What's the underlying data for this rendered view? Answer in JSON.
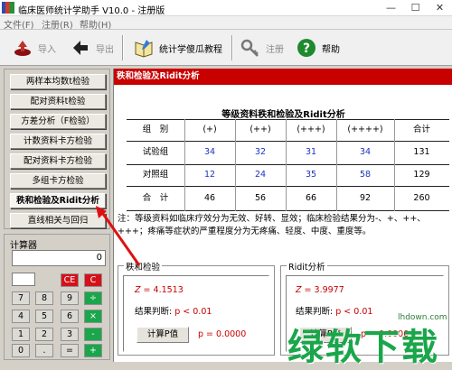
{
  "window": {
    "title": "临床医师统计学助手 V10.0 - 注册版",
    "min": "—",
    "max": "☐",
    "close": "✕"
  },
  "menu": [
    "文件(F)",
    "注册(R)",
    "帮助(H)"
  ],
  "toolbar": {
    "import": "导入",
    "export": "导出",
    "tutorial": "统计学傻瓜教程",
    "register": "注册",
    "help": "帮助"
  },
  "nav": [
    "两样本均数t检验",
    "配对资料t检验",
    "方差分析（F检验）",
    "计数资料卡方检验",
    "配对资料卡方检验",
    "多组卡方检验",
    "秩和检验及Ridit分析",
    "直线相关与回归"
  ],
  "calculator": {
    "title": "计算器",
    "display": "0",
    "keys": [
      "CE",
      "C",
      "7",
      "8",
      "9",
      "÷",
      "4",
      "5",
      "6",
      "×",
      "1",
      "2",
      "3",
      "-",
      "0",
      ".",
      "=",
      "+"
    ]
  },
  "content": {
    "header": "秩和检验及Ridit分析",
    "report_title": "等级资料秩和检验及Ridit分析",
    "table": {
      "headers": [
        "组　别",
        "(+)",
        "(++)",
        "(+++)",
        "(++++)",
        "合计"
      ],
      "rows": [
        [
          "试验组",
          "34",
          "32",
          "31",
          "34",
          "131"
        ],
        [
          "对照组",
          "12",
          "24",
          "35",
          "58",
          "129"
        ],
        [
          "合　计",
          "46",
          "56",
          "66",
          "92",
          "260"
        ]
      ]
    },
    "note": "注：等级资料如临床疗效分为无效、好转、显效；临床检验结果分为-、+、++、+++；疼痛等症状的严重程度分为无疼痛、轻度、中度、重度等。"
  },
  "rank_test": {
    "label": "秩和检验",
    "z_label": "Z",
    "z_value": "= 4.1513",
    "conclusion": "结果判断:",
    "p_text": "p < 0.01",
    "button": "计算P值",
    "p_value": "p = 0.0000"
  },
  "ridit": {
    "label": "Ridit分析",
    "z_label": "Z",
    "z_value": "= 3.9977",
    "conclusion": "结果判断:",
    "p_text": "p < 0.01",
    "button": "计算P值",
    "p_value": "p = 0.0000"
  },
  "watermark": {
    "text": "绿软下载",
    "site": "lhdown.com"
  },
  "colors": {
    "accent": "#c80000",
    "number": "#1c33c0",
    "watermark": "#1aa64a"
  }
}
